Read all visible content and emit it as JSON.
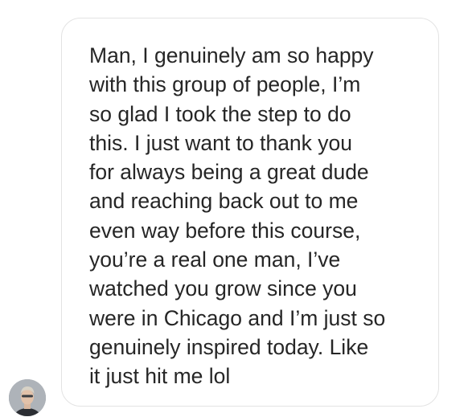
{
  "message": {
    "lines": [
      "Man, I genuinely am so happy",
      "with this group of people, I’m",
      "so glad I took the step to do",
      "this. I just want to thank you",
      "for always being a great dude",
      "and reaching back out to me",
      "even way before this course,",
      "you’re a real one man, I’ve",
      "watched you grow since you",
      "were in Chicago and I’m just so",
      "genuinely inspired today. Like",
      "it just hit me lol"
    ]
  },
  "sender": {
    "avatar_icon": "profile-photo-icon"
  },
  "colors": {
    "text": "#262626",
    "bubble_border": "#e3e3e3",
    "background": "#ffffff"
  }
}
